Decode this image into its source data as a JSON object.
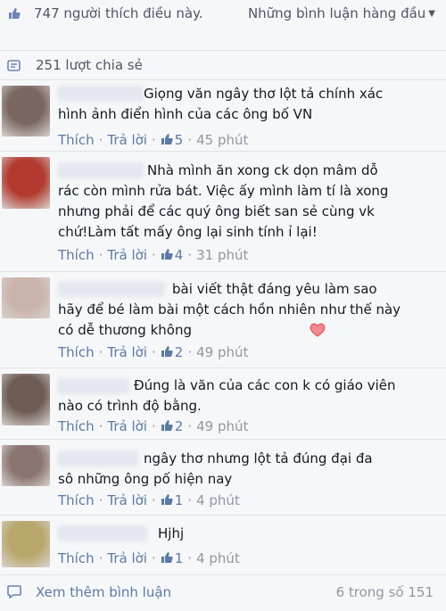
{
  "header": {
    "likes_text": "747 người thích điều này.",
    "sort_label": "Những bình luận hàng đầu",
    "sort_caret": "▼",
    "shares_text": "251 lượt chia sẻ"
  },
  "action_labels": {
    "like": "Thích",
    "reply": "Trả lời",
    "separator": "·"
  },
  "comments": [
    {
      "text": "Giọng văn ngây thơ lột tả chính xác\nhình ảnh điển hình của các ông bố VN",
      "likes": "5",
      "time": "45 phút",
      "avatar_color": "#7a6660"
    },
    {
      "text": "Nhà mình ăn xong ck dọn mâm dỗ\nrác còn mình rửa bát. Việc ấy mình làm tí là xong\nnhưng phải để các quý ông biết san sẻ cùng vk\nchứ!Làm tất mấy ông lại sinh tính ỉ lại!",
      "likes": "4",
      "time": "31 phút",
      "avatar_color": "#b23a2e"
    },
    {
      "text": "bài viết thật đáng yêu làm sao\nhãy để bé làm bài một cách hồn nhiên như thế này\ncó dễ thương không",
      "likes": "2",
      "time": "49 phút",
      "avatar_color": "#c9b3aa"
    },
    {
      "text": "Đúng là văn của các con k có giáo viên\nnào có trình độ bằng.",
      "likes": "2",
      "time": "49 phút",
      "avatar_color": "#6e5d55"
    },
    {
      "text": "ngây thơ nhưng lột tả đúng đại đa\nsô những ông pố hiện nay",
      "likes": "1",
      "time": "4 phút",
      "avatar_color": "#8a7470"
    },
    {
      "text": "Hjhj",
      "likes": "1",
      "time": "4 phút",
      "avatar_color": "#b8a66a"
    }
  ],
  "footer": {
    "more_text": "Xem thêm bình luận",
    "pager_text": "6 trong số 151"
  },
  "colors": {
    "link": "#5d7aa3",
    "muted": "#9197a3",
    "heart": "#e0474c"
  }
}
